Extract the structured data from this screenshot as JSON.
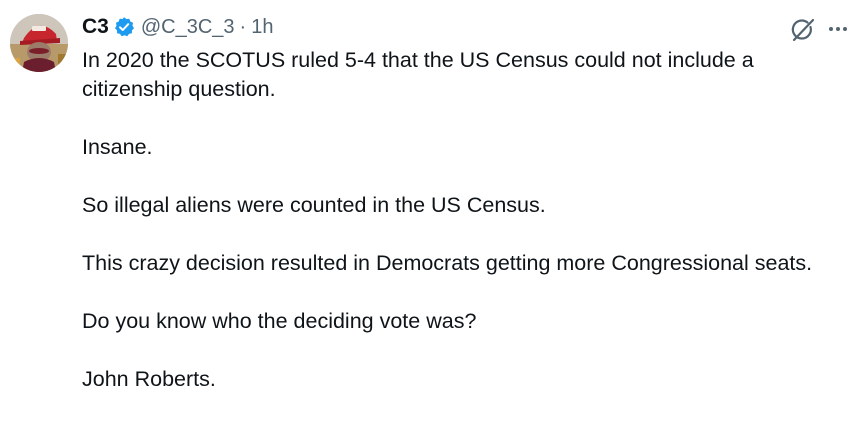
{
  "tweet": {
    "display_name": "C3",
    "handle": "@C_3C_3",
    "separator": "·",
    "timestamp": "1h",
    "paragraphs": [
      "In 2020 the SCOTUS ruled 5-4 that the US Census could not include a citizenship question.",
      "Insane.",
      "So illegal aliens were counted in the US Census.",
      "This crazy decision resulted in Democrats getting more Congressional seats.",
      "Do you know who the deciding vote was?",
      "John Roberts."
    ]
  },
  "icons": {
    "verified": "verified-badge-icon",
    "grok": "grok-icon",
    "more": "more-options-icon"
  },
  "colors": {
    "text": "#0f1419",
    "secondary": "#536471",
    "verified": "#1d9bf0"
  }
}
